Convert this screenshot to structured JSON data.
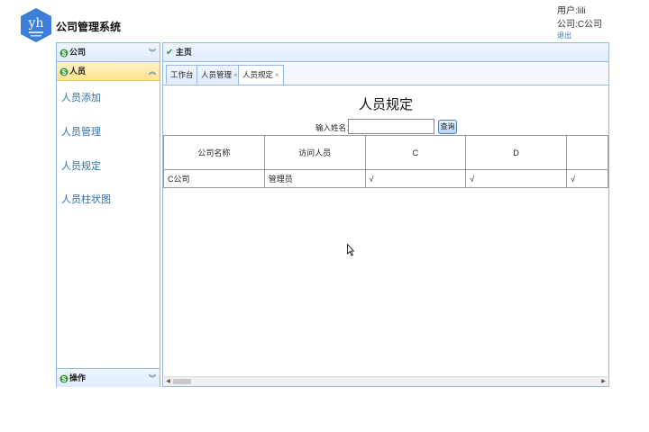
{
  "header": {
    "logo_text": "yh",
    "system_title": "公司管理系统",
    "user_line": "用户:lili",
    "company_line": "公司:C公司",
    "logout_link": "退出"
  },
  "sidebar": {
    "sections": [
      {
        "label": "公司",
        "expanded": false
      },
      {
        "label": "人员",
        "expanded": true
      },
      {
        "label": "操作",
        "expanded": false
      }
    ],
    "items": [
      {
        "label": "人员添加"
      },
      {
        "label": "人员管理"
      },
      {
        "label": "人员规定"
      },
      {
        "label": "人员柱状图"
      }
    ]
  },
  "main": {
    "header_label": "主页",
    "tabs": [
      {
        "label": "工作台",
        "closable": false
      },
      {
        "label": "人员管理",
        "closable": true,
        "close": "×"
      },
      {
        "label": "人员规定",
        "closable": true,
        "close": "×",
        "selected": true
      }
    ],
    "page_heading": "人员规定",
    "search": {
      "label": "输入姓名：",
      "value": "",
      "button": "查询"
    },
    "table": {
      "columns": [
        "公司名称",
        "访问人员",
        "C",
        "D",
        ""
      ],
      "rows": [
        [
          "C公司",
          "管理员",
          "√",
          "√",
          "√"
        ]
      ]
    }
  },
  "colors": {
    "border": "#95b8e7",
    "active_header": "#ffe48d",
    "link": "#2e6fb0"
  }
}
